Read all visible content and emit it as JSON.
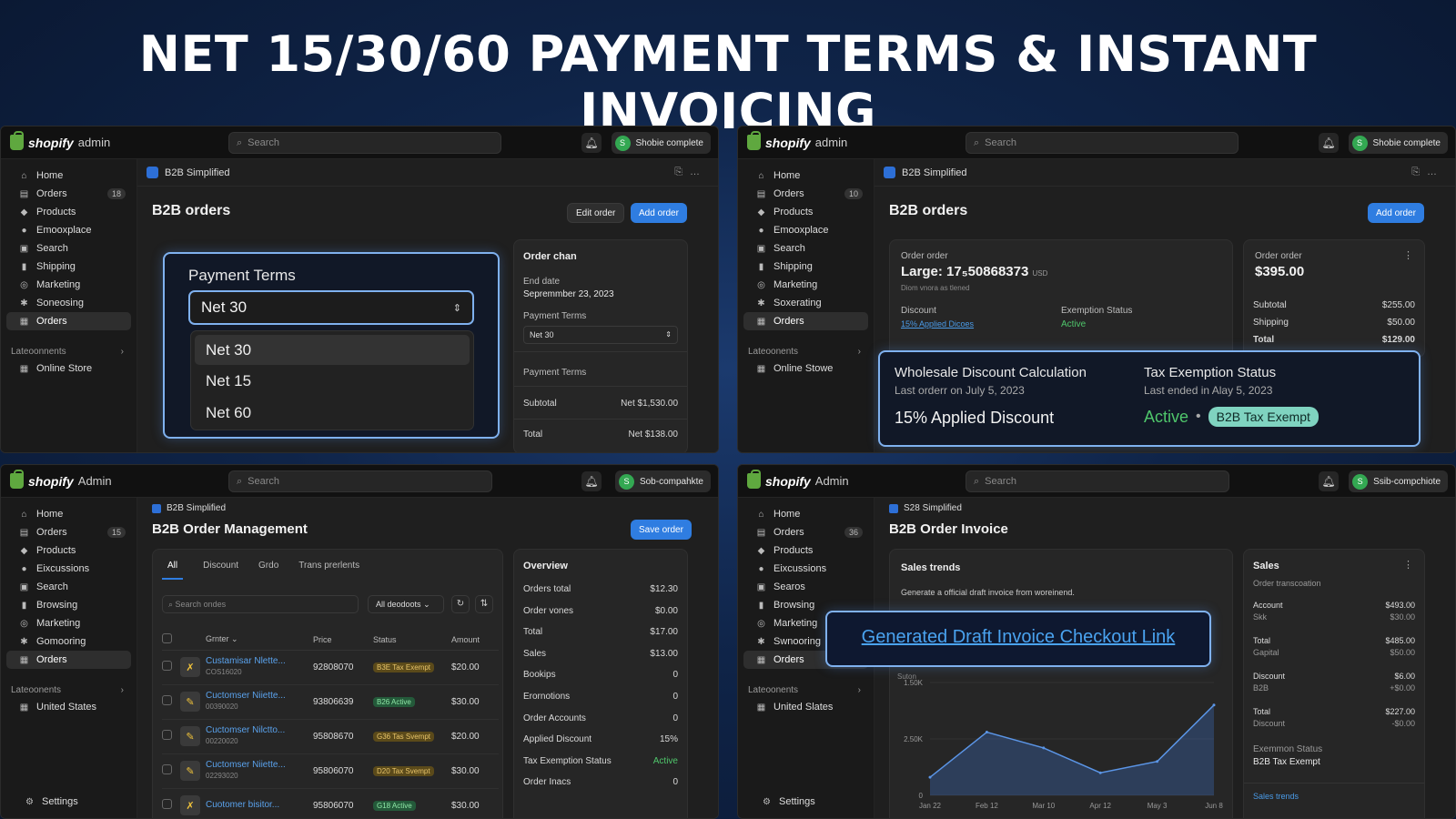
{
  "headline": "NET 15/30/60 PAYMENT TERMS & INSTANT INVOICING",
  "search_placeholder": "Search",
  "panels": {
    "p1": {
      "logo_brand": "shopify",
      "logo_suffix": "admin",
      "store": "Shobie complete",
      "sidebar": [
        {
          "label": "Home",
          "icon": "home-icon",
          "glyph": "⌂"
        },
        {
          "label": "Orders",
          "icon": "orders-icon",
          "glyph": "▤",
          "count": "18"
        },
        {
          "label": "Products",
          "icon": "tag-icon",
          "glyph": "◆"
        },
        {
          "label": "Emooxplace",
          "icon": "person-icon",
          "glyph": "●"
        },
        {
          "label": "Search",
          "icon": "search-icon",
          "glyph": "▣"
        },
        {
          "label": "Shipping",
          "icon": "chart-icon",
          "glyph": "▮"
        },
        {
          "label": "Marketing",
          "icon": "target-icon",
          "glyph": "◎"
        },
        {
          "label": "Soneosing",
          "icon": "gear-icon",
          "glyph": "✱"
        },
        {
          "label": "Orders",
          "icon": "orders-icon",
          "glyph": "▦",
          "active": true
        }
      ],
      "section": "Lateoonnents",
      "section_item": "Online Store",
      "app": "B2B Simplified",
      "title": "B2B orders",
      "edit_btn": "Edit order",
      "add_btn": "Add order",
      "terms_label": "Payment Terms",
      "terms_selected": "Net 30",
      "terms_options": [
        "Net 30",
        "Net 15",
        "Net 60"
      ],
      "side": {
        "title": "Order chan",
        "end_label": "End date",
        "end_value": "Sepremmber 23, 2023",
        "terms_label": "Payment Terms",
        "terms_value": "Net 30",
        "terms_label2": "Payment Terms",
        "subtotal_label": "Subtotal",
        "subtotal_value": "Net $1,530.00",
        "total_label": "Total",
        "total_value": "Net $138.00"
      }
    },
    "p2": {
      "logo_brand": "shopify",
      "logo_suffix": "admin",
      "store": "Shobie complete",
      "sidebar": [
        {
          "label": "Home",
          "icon": "home-icon",
          "glyph": "⌂"
        },
        {
          "label": "Orders",
          "icon": "orders-icon",
          "glyph": "▤",
          "count": "10"
        },
        {
          "label": "Products",
          "icon": "tag-icon",
          "glyph": "◆"
        },
        {
          "label": "Emooxplace",
          "icon": "person-icon",
          "glyph": "●"
        },
        {
          "label": "Search",
          "icon": "search-icon",
          "glyph": "▣"
        },
        {
          "label": "Shipping",
          "icon": "chart-icon",
          "glyph": "▮"
        },
        {
          "label": "Marketing",
          "icon": "target-icon",
          "glyph": "◎"
        },
        {
          "label": "Soxerating",
          "icon": "gear-icon",
          "glyph": "✱"
        },
        {
          "label": "Orders",
          "icon": "orders-icon",
          "glyph": "▦",
          "active": true
        }
      ],
      "section": "Lateoonents",
      "section_item": "Online Stowe",
      "app": "B2B Simplified",
      "title": "B2B orders",
      "add_btn": "Add order",
      "left_card": {
        "label": "Order order",
        "large": "Large: 17₅50868373",
        "currency": "USD",
        "sub": "Diom vnora as tlened",
        "discount_label": "Discount",
        "discount_link": "15% Applied Dicoes",
        "exempt_label": "Exemption Status",
        "exempt_value": "Active"
      },
      "right_card": {
        "label": "Order order",
        "amount": "$395.00",
        "rows": [
          [
            "Subtotal",
            "$255.00"
          ],
          [
            "Shipping",
            "$50.00"
          ],
          [
            "Total",
            "$129.00"
          ]
        ]
      },
      "highlight": {
        "h1": "Wholesale Discount Calculation",
        "s1": "Last orderr on July 5, 2023",
        "big1": "15% Applied Discount",
        "h2": "Tax Exemption Status",
        "s2": "Last ended in Alay 5, 2023",
        "active": "Active",
        "sep": "•",
        "badge": "B2B Tax Exempt"
      }
    },
    "p3": {
      "logo_brand": "shopify",
      "logo_suffix": "Admin",
      "store": "Sob-compahkte",
      "sidebar": [
        {
          "label": "Home",
          "icon": "home-icon",
          "glyph": "⌂"
        },
        {
          "label": "Orders",
          "icon": "orders-icon",
          "glyph": "▤",
          "count": "15"
        },
        {
          "label": "Products",
          "icon": "tag-icon",
          "glyph": "◆"
        },
        {
          "label": "Eixcussions",
          "icon": "person-icon",
          "glyph": "●"
        },
        {
          "label": "Search",
          "icon": "search-icon",
          "glyph": "▣"
        },
        {
          "label": "Browsing",
          "icon": "chart-icon",
          "glyph": "▮"
        },
        {
          "label": "Marketing",
          "icon": "target-icon",
          "glyph": "◎"
        },
        {
          "label": "Gomooring",
          "icon": "gear-icon",
          "glyph": "✱"
        },
        {
          "label": "Orders",
          "icon": "orders-icon",
          "glyph": "▦",
          "active": true
        }
      ],
      "section": "Lateoonents",
      "section_item": "United States",
      "settings": "Settings",
      "app": "B2B Simplified",
      "title": "B2B Order Management",
      "save_btn": "Save order",
      "tabs": [
        "All",
        "Discount",
        "Grdo",
        "Trans prerlents"
      ],
      "search": "Search ondes",
      "filter": "All deodoots",
      "columns": [
        "Grnter",
        "Price",
        "Status",
        "Amount"
      ],
      "rows": [
        {
          "name": "Custamisar Nlette...",
          "id": "COS16020",
          "price": "92808070",
          "status": "B3E Tax Exempt",
          "amount": "$20.00",
          "thumb": "✗"
        },
        {
          "name": "Cuctomser Niiette...",
          "id": "00390020",
          "price": "93806639",
          "status": "B26 Active",
          "amount": "$30.00",
          "thumb": "✎"
        },
        {
          "name": "Cuctomser Nilctto...",
          "id": "00220020",
          "price": "95808670",
          "status": "G36 Tas Svempt",
          "amount": "$20.00",
          "thumb": "✎"
        },
        {
          "name": "Cuctomser Niiette...",
          "id": "02293020",
          "price": "95806070",
          "status": "D20 Tax Svempt",
          "amount": "$30.00",
          "thumb": "✎"
        },
        {
          "name": "Cuotomer bisitor...",
          "id": "",
          "price": "95806070",
          "status": "G18 Active",
          "amount": "$30.00",
          "thumb": "✗"
        }
      ],
      "overview_title": "Overview",
      "overview": [
        [
          "Orders total",
          "$12.30"
        ],
        [
          "Order vones",
          "$0.00"
        ],
        [
          "Total",
          "$17.00"
        ],
        [
          "Sales",
          "$13.00"
        ],
        [
          "Bookips",
          "0"
        ],
        [
          "Erornotions",
          "0"
        ],
        [
          "Order Accounts",
          "0"
        ],
        [
          "Applied Discount",
          "15%"
        ],
        [
          "Tax Exemption Status",
          "Active"
        ],
        [
          "Order Inacs",
          "0"
        ]
      ]
    },
    "p4": {
      "logo_brand": "shopify",
      "logo_suffix": "Admin",
      "store": "Ssib-compchiote",
      "sidebar": [
        {
          "label": "Home",
          "icon": "home-icon",
          "glyph": "⌂"
        },
        {
          "label": "Orders",
          "icon": "orders-icon",
          "glyph": "▤",
          "count": "36"
        },
        {
          "label": "Products",
          "icon": "tag-icon",
          "glyph": "◆"
        },
        {
          "label": "Eixcussions",
          "icon": "person-icon",
          "glyph": "●"
        },
        {
          "label": "Searos",
          "icon": "search-icon",
          "glyph": "▣"
        },
        {
          "label": "Browsing",
          "icon": "chart-icon",
          "glyph": "▮"
        },
        {
          "label": "Marketing",
          "icon": "target-icon",
          "glyph": "◎"
        },
        {
          "label": "Swnooring",
          "icon": "gear-icon",
          "glyph": "✱"
        },
        {
          "label": "Orders",
          "icon": "orders-icon",
          "glyph": "▦",
          "active": true
        }
      ],
      "section": "Lateoonents",
      "section_item": "United Slates",
      "settings": "Settings",
      "app": "S28 Simplified",
      "title": "B2B Order Invoice",
      "trends_title": "Sales trends",
      "trends_text": "Generate a official draft invoice from woreinend.",
      "link": "Generated Draft Invoice Checkout Link",
      "sales_title": "Sales",
      "sales_sub": "Order transcoation",
      "sales_rows": [
        [
          "Account",
          "$493.00",
          "Skk",
          "$30.00"
        ],
        [
          "Total",
          "$485.00",
          "Gapital",
          "$50.00"
        ],
        [
          "Discount",
          "$6.00",
          "B2B",
          "+$0.00"
        ],
        [
          "Total",
          "$227.00",
          "Discount",
          "-$0.00"
        ]
      ],
      "exempt_label": "Exemmon Status",
      "exempt_value": "B2B Tax Exempt",
      "footer_link": "Sales trends"
    }
  },
  "chart_data": {
    "type": "area",
    "title": "",
    "ylabel": "Suton",
    "categories": [
      "Jan 22",
      "Feb 12",
      "Mar 10",
      "Apr 12",
      "May 3",
      "Jun 8"
    ],
    "series": [
      {
        "values": [
          400,
          1400,
          1050,
          500,
          750,
          2000
        ]
      }
    ],
    "ytick_labels": [
      "0",
      "2.50K",
      "1.50K"
    ],
    "ylim": [
      0,
      2500
    ]
  },
  "colors": {
    "accent": "#2f7de1",
    "highlight_border": "#7fb1ef",
    "active_green": "#4fc66b",
    "brand_green": "#5fa83f"
  }
}
